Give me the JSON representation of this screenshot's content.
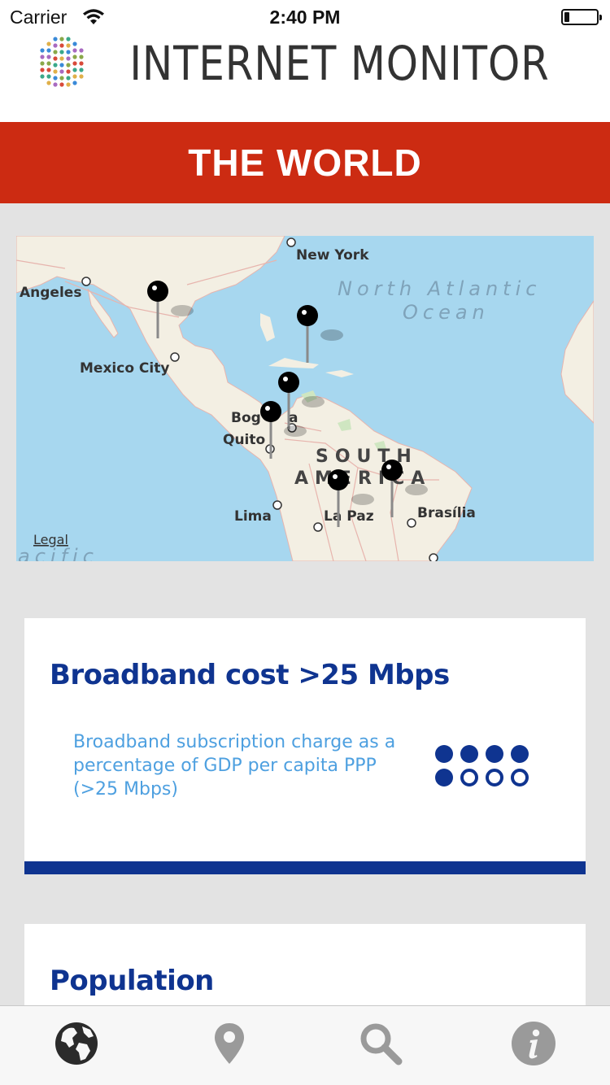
{
  "status_bar": {
    "carrier": "Carrier",
    "time": "2:40 PM",
    "battery_level": 0.15
  },
  "header": {
    "title": "INTERNET MONITOR",
    "logo_icon": "dot-grid-logo"
  },
  "banner": {
    "title": "THE WORLD",
    "color": "#cc2b12"
  },
  "map": {
    "legal_label": "Legal",
    "place_labels": {
      "new_york": "New York",
      "los_angeles": "Angeles",
      "mexico_city": "Mexico City",
      "bogota": "Bog",
      "bogota_suffix": "a",
      "quito": "Quito",
      "lima": "Lima",
      "la_paz": "La Paz",
      "brasilia": "Brasília"
    },
    "ocean_labels": {
      "line1": "North Atlantic",
      "line2": "Ocean",
      "pacific": "acific"
    },
    "region_labels": {
      "line1": "SOUTH",
      "line2": "AMERICA"
    },
    "pin_icon": "map-pin-icon"
  },
  "cards": [
    {
      "title": "Broadband cost >25 Mbps",
      "description": "Broadband subscription charge as a percentage of GDP per capita PPP (>25 Mbps)",
      "rating": {
        "filled": 5,
        "total": 8
      }
    },
    {
      "title": "Population"
    }
  ],
  "tabs": [
    {
      "icon": "globe-icon",
      "active": true
    },
    {
      "icon": "location-pin-icon",
      "active": false
    },
    {
      "icon": "search-icon",
      "active": false
    },
    {
      "icon": "info-icon",
      "active": false
    }
  ],
  "colors": {
    "accent_blue": "#0f3490",
    "desc_blue": "#4ea0e0",
    "banner_red": "#cc2b12",
    "tab_inactive": "#9a9a9a",
    "tab_active": "#2b2b2b"
  }
}
